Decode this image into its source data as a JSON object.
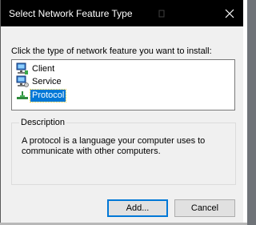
{
  "window": {
    "title": "Select Network Feature Type"
  },
  "prompt": "Click the type of network feature you want to install:",
  "feature_list": {
    "items": [
      {
        "label": "Client",
        "icon": "client-computer-icon",
        "selected": false
      },
      {
        "label": "Service",
        "icon": "service-computer-icon",
        "selected": false
      },
      {
        "label": "Protocol",
        "icon": "protocol-network-icon",
        "selected": true
      }
    ]
  },
  "description": {
    "legend": "Description",
    "text": "A protocol is a language your computer uses to communicate with other computers."
  },
  "buttons": {
    "add": "Add...",
    "cancel": "Cancel"
  },
  "colors": {
    "titlebar": "#000000",
    "selection": "#0078d7",
    "dialog_bg": "#f0f0f0"
  }
}
